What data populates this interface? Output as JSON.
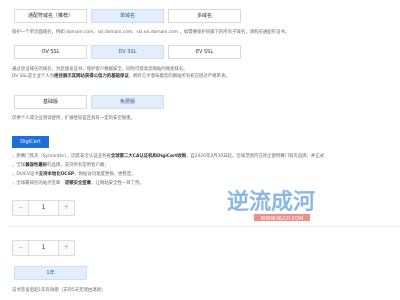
{
  "domain_type": {
    "options": [
      "通配符域名（推荐）",
      "单域名",
      "多域名"
    ],
    "selected": "单域名",
    "description": "保护一个单页面域名，例如 domain.com、ssl.domain.com、ssl.ssl.domain.com ，如需要保护同级下的所有子域名，请购买通配符证书。"
  },
  "validation": {
    "options": [
      "OV SSL",
      "DV SSL",
      "EV SSL"
    ],
    "selected": "DV SSL",
    "description_lines": [
      {
        "plain1": "通过验证域名的域名，为您颁发证书，保护客户数据安全，同时可提高您网站的搜索排名。",
        "bold": "",
        "plain2": ""
      },
      {
        "plain1": "DV SSL是企业个人为",
        "bold": "绝佳展示其网站获得公信力的基础保证",
        "plain2": "，拥有它才意味着您的网站所有权已经过严格审查。"
      }
    ]
  },
  "edition": {
    "options": [
      "基础版",
      "免费版"
    ],
    "selected": "免费版",
    "description": "仅供个人或企业测试使用，扩展性较差且具有一定的安全隐患。"
  },
  "brand": {
    "label": "DigiCert",
    "description_lines": [
      {
        "plain1": "，原赛门铁克（Symantec），因其安全认证业务被",
        "bold": "全球第二大CA认证机构DigiCert收购",
        "plain2": "，自2020年4月30日起，全球范围内已停止使用赛门铁克品牌，并正式"
      },
      {
        "plain1": "，全球",
        "bold": "兼容性最好",
        "plain2": "的品牌，支持所有常用客户端；"
      },
      {
        "plain1": "，DV/EV证书",
        "bold": "支持本地化OCSP",
        "plain2": "，网站访问速度更快、更稳定。"
      },
      {
        "plain1": "，全球最知名的站点签章 - ",
        "bold": "诺顿安全签章",
        "plain2": "，让网站安全性一目了然。"
      }
    ]
  },
  "domain_count": {
    "decrement": "−",
    "value": "1",
    "increment": "+"
  },
  "purchase_years": {
    "decrement": "−",
    "value": "1",
    "increment": "+"
  },
  "term": {
    "label": "1年",
    "note": "证书签发后起1年有效期（支持5天无理由退款）"
  },
  "watermark": {
    "text": "逆流成河",
    "subtext": "WWW.NLCH.COM"
  },
  "colors": {
    "selected_bg": "#e3eefb",
    "brand_blue": "#1e6fd9",
    "watermark_blue": "#2e7bd6",
    "watermark_red": "#e0342c"
  }
}
